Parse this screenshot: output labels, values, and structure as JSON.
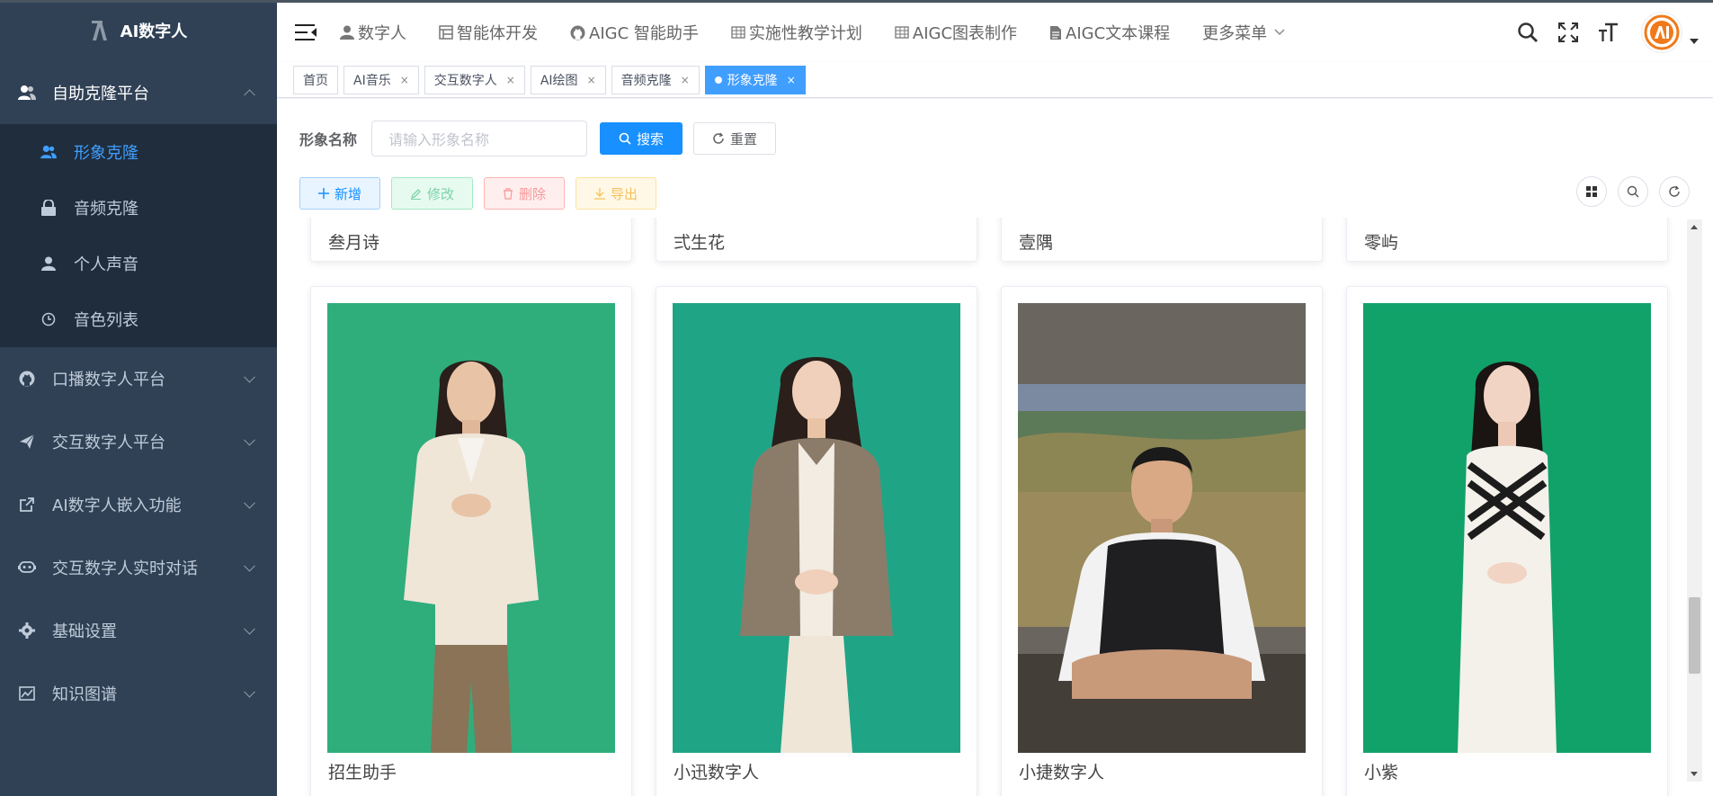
{
  "app": {
    "title": "AI数字人"
  },
  "sidebar": {
    "sections": [
      {
        "label": "自助克隆平台",
        "icon": "user-group-icon",
        "expanded": true,
        "children": [
          {
            "label": "形象克隆",
            "icon": "user-group-icon",
            "active": true
          },
          {
            "label": "音频克隆",
            "icon": "lock-icon"
          },
          {
            "label": "个人声音",
            "icon": "user-icon"
          },
          {
            "label": "音色列表",
            "icon": "clock-icon"
          }
        ]
      },
      {
        "label": "口播数字人平台",
        "icon": "github-icon"
      },
      {
        "label": "交互数字人平台",
        "icon": "send-icon"
      },
      {
        "label": "AI数字人嵌入功能",
        "icon": "external-link-icon"
      },
      {
        "label": "交互数字人实时对话",
        "icon": "robot-icon"
      },
      {
        "label": "基础设置",
        "icon": "gear-icon"
      },
      {
        "label": "知识图谱",
        "icon": "chart-icon"
      }
    ]
  },
  "navbar": {
    "items": [
      {
        "label": "数字人",
        "icon": "user-icon"
      },
      {
        "label": "智能体开发",
        "icon": "tree-table-icon"
      },
      {
        "label": "AIGC 智能助手",
        "icon": "github-icon"
      },
      {
        "label": "实施性教学计划",
        "icon": "table-icon"
      },
      {
        "label": "AIGC图表制作",
        "icon": "table-icon"
      },
      {
        "label": "AIGC文本课程",
        "icon": "document-icon"
      },
      {
        "label": "更多菜单",
        "icon": "chevron-down-icon"
      }
    ]
  },
  "tags": [
    {
      "label": "首页",
      "closable": false,
      "active": false
    },
    {
      "label": "AI音乐",
      "closable": true,
      "active": false
    },
    {
      "label": "交互数字人",
      "closable": true,
      "active": false
    },
    {
      "label": "AI绘图",
      "closable": true,
      "active": false
    },
    {
      "label": "音频克隆",
      "closable": true,
      "active": false
    },
    {
      "label": "形象克隆",
      "closable": true,
      "active": true
    }
  ],
  "tag_close": "×",
  "search": {
    "label": "形象名称",
    "placeholder": "请输入形象名称",
    "search_btn": "搜索",
    "reset_btn": "重置"
  },
  "actions": {
    "add": "新增",
    "edit": "修改",
    "delete": "删除",
    "export": "导出"
  },
  "cards_top": [
    "叁月诗",
    "弍生花",
    "壹隅",
    "零屿"
  ],
  "cards_bottom": [
    "招生助手",
    "小迅数字人",
    "小捷数字人",
    "小紫"
  ],
  "colors": {
    "sidebar_bg": "#304156",
    "submenu_bg": "#1f2d3d",
    "accent": "#409eff",
    "primary_btn": "#1890ff"
  }
}
